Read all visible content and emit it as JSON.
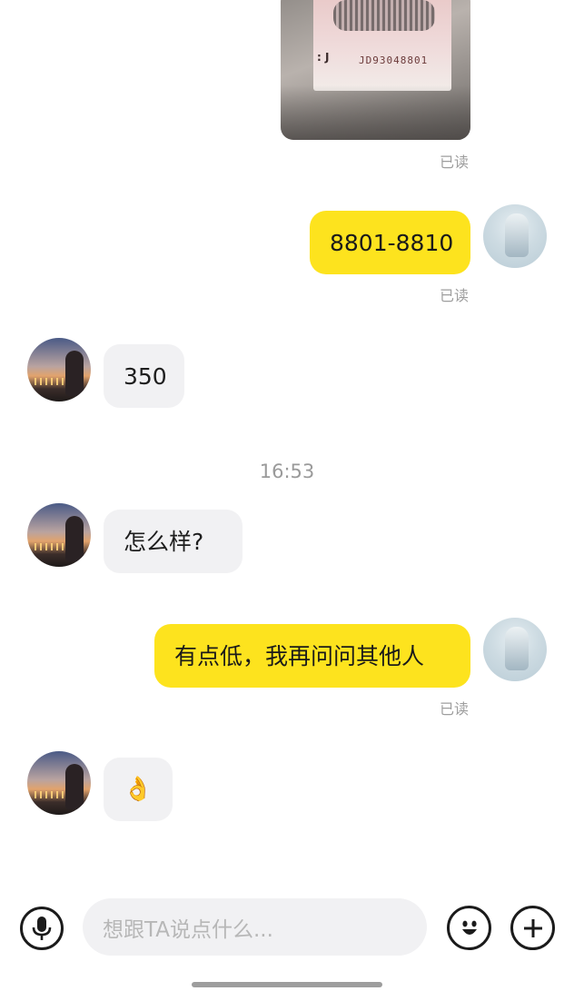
{
  "messages": {
    "image_message": {
      "serial": "JD93048801",
      "marks": ": J",
      "read_label": "已读"
    },
    "me_1": {
      "text": "8801-8810",
      "read_label": "已读"
    },
    "them_1": {
      "text": "350"
    },
    "timestamp": "16:53",
    "them_2": {
      "text": "怎么样?"
    },
    "me_2": {
      "text": "有点低，我再问问其他人",
      "read_label": "已读"
    },
    "them_3": {
      "text": "👌"
    }
  },
  "input_bar": {
    "placeholder": "想跟TA说点什么..."
  }
}
